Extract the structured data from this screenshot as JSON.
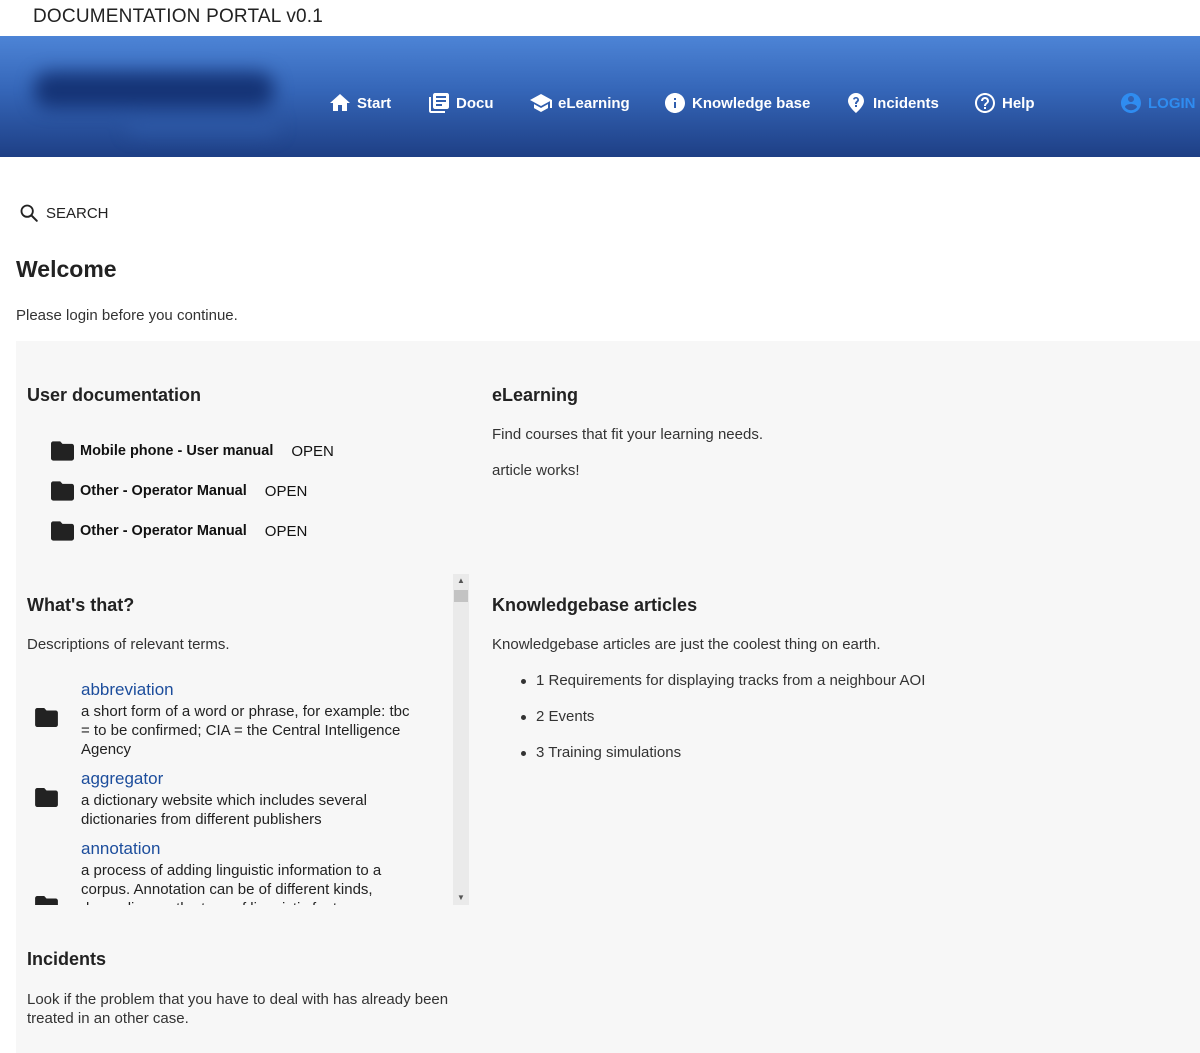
{
  "app": {
    "title": "DOCUMENTATION PORTAL v0.1"
  },
  "nav": {
    "start": "Start",
    "docu": "Docu",
    "elearning": "eLearning",
    "knowledge": "Knowledge base",
    "incidents": "Incidents",
    "help": "Help",
    "login": "LOGIN"
  },
  "search": {
    "label": "SEARCH"
  },
  "welcome": {
    "title": "Welcome",
    "text": "Please login before you continue."
  },
  "user_docs": {
    "title": "User documentation",
    "items": [
      {
        "name": "Mobile phone - User manual",
        "action": "OPEN"
      },
      {
        "name": "Other - Operator Manual",
        "action": "OPEN"
      },
      {
        "name": "Other - Operator Manual",
        "action": "OPEN"
      }
    ]
  },
  "elearning": {
    "title": "eLearning",
    "text": "Find courses that fit your learning needs.",
    "note": "article works!"
  },
  "whats_that": {
    "title": "What's that?",
    "text": "Descriptions of relevant terms.",
    "terms": [
      {
        "name": "abbreviation",
        "desc": "a short form of a word or phrase, for example: tbc = to be confirmed; CIA = the Central Intelligence Agency"
      },
      {
        "name": "aggregator",
        "desc": "a dictionary website which includes several dictionaries from different publishers"
      },
      {
        "name": "annotation",
        "desc": "a process of adding linguistic information to a corpus. Annotation can be of different kinds, depending on the type of linguistic features"
      }
    ]
  },
  "knowledgebase": {
    "title": "Knowledgebase articles",
    "text": "Knowledgebase articles are just the coolest thing on earth.",
    "items": [
      "1 Requirements for displaying tracks from a neighbour AOI",
      "2 Events",
      "3 Training simulations"
    ]
  },
  "incidents": {
    "title": "Incidents",
    "text": "Look if the problem that you have to deal with has already been treated in an other case."
  },
  "colors": {
    "banner_top": "#4d84d6",
    "banner_bottom": "#1e3f85",
    "link": "#1c4d9c",
    "login": "#2f8cf0",
    "panel": "#f7f7f7"
  }
}
